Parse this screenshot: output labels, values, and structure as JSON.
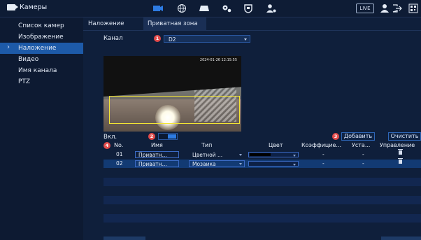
{
  "topbar": {
    "title": "Камеры",
    "live": "LIVE",
    "icons": [
      "camera-icon",
      "globe-icon",
      "storage-icon",
      "settings-icon",
      "shield-icon",
      "account-icon",
      "user-icon",
      "logout-icon",
      "qr-icon"
    ],
    "accent": "#2d7be3"
  },
  "sidebar": {
    "items": [
      {
        "label": "Список камер"
      },
      {
        "label": "Изображение"
      },
      {
        "label": "Наложение"
      },
      {
        "label": "Видео"
      },
      {
        "label": "Имя канала"
      },
      {
        "label": "PTZ"
      }
    ],
    "active_index": 2
  },
  "tabs": [
    {
      "label": "Наложение"
    },
    {
      "label": "Приватная зона"
    }
  ],
  "channel": {
    "label": "Канал",
    "value": "D2",
    "marker": "1"
  },
  "preview": {
    "timestamp": "2024-01-26 12:15:55"
  },
  "enable": {
    "label": "Вкл.",
    "marker": "2"
  },
  "buttons": {
    "add_marker": "3",
    "add": "Добавить",
    "clear": "Очистить"
  },
  "table": {
    "marker": "4",
    "headers": {
      "no": "No.",
      "name": "Имя",
      "type": "Тип",
      "color": "Цвет",
      "coef": "Коэффицие...",
      "set": "Уста...",
      "manage": "Управление"
    },
    "rows": [
      {
        "no": "01",
        "name": "Приватн...",
        "type": "Цветной ...",
        "coef": "-",
        "set": "-"
      },
      {
        "no": "02",
        "name": "Приватн...",
        "type": "Мозаика",
        "coef": "-",
        "set": "-"
      }
    ]
  }
}
